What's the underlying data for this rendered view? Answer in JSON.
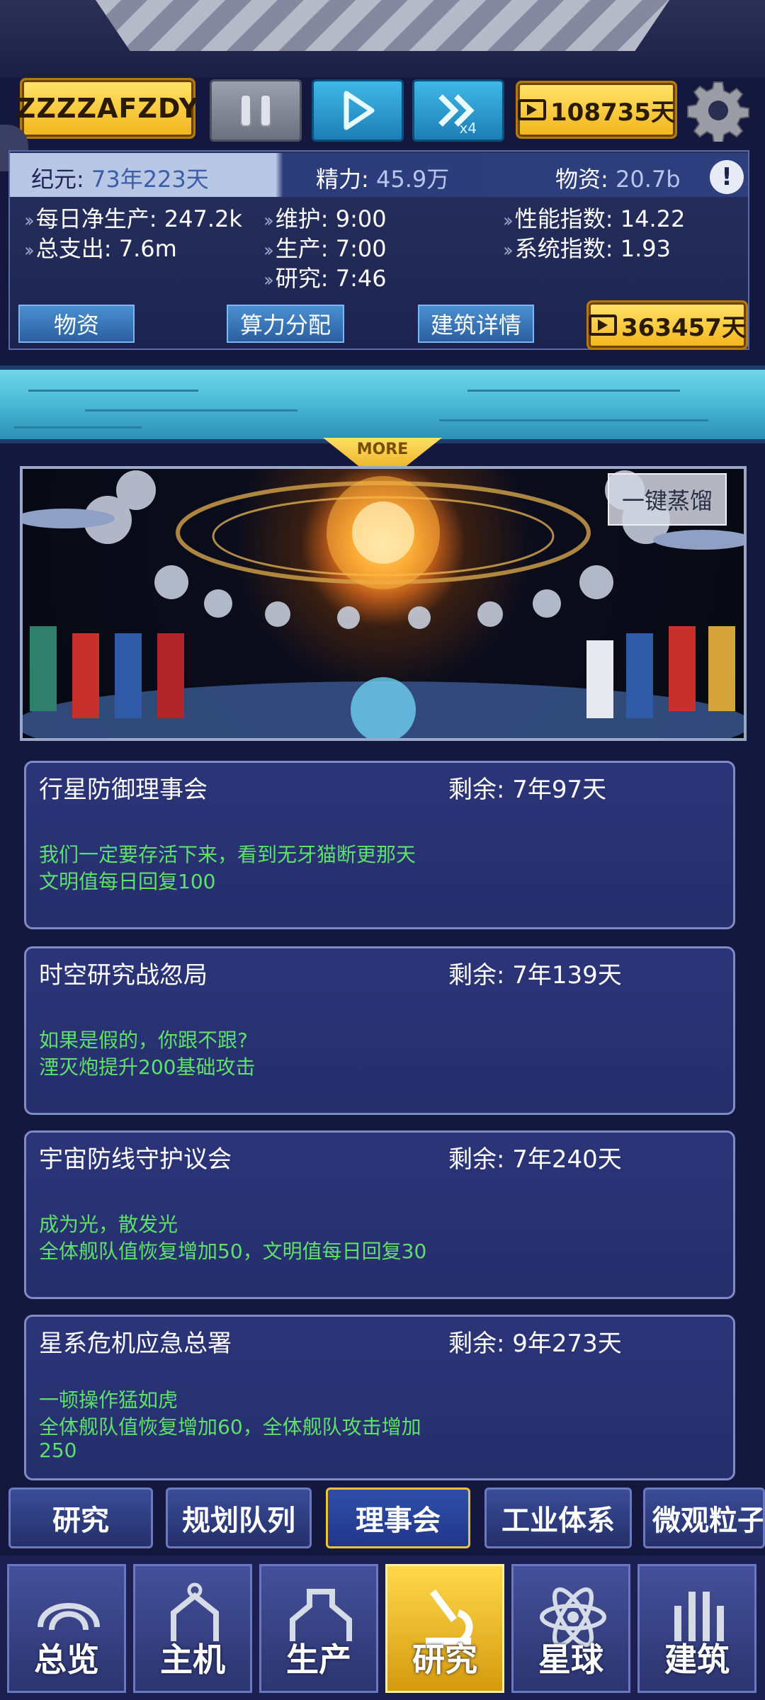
{
  "toolbar": {
    "player_name": "ZZZZAFZDY",
    "speed_multiplier": "x4",
    "time_ad_label": "108735天"
  },
  "stats": {
    "era_label": "纪元:",
    "era_value": "73年223天",
    "energy_label": "精力:",
    "energy_value": "45.9万",
    "materials_label": "物资:",
    "materials_value": "20.7b",
    "alert": "!",
    "daily_net_production": "每日净生产: 247.2k",
    "total_spending": "总支出: 7.6m",
    "maintenance": "维护: 9:00",
    "production": "生产: 7:00",
    "research": "研究: 7:46",
    "performance_index": "性能指数: 14.22",
    "system_index": "系统指数: 1.93",
    "buttons": {
      "materials": "物资",
      "compute": "算力分配",
      "building_details": "建筑详情",
      "ad_time": "363457天"
    }
  },
  "banner": {
    "more_label": "MORE",
    "distill_button": "一键蒸馏"
  },
  "council": [
    {
      "title": "行星防御理事会",
      "remaining": "剩余: 7年97天",
      "lines": [
        "我们一定要存活下来，看到无牙猫断更那天",
        "文明值每日回复100"
      ]
    },
    {
      "title": "时空研究战忽局",
      "remaining": "剩余: 7年139天",
      "lines": [
        "如果是假的，你跟不跟?",
        "湮灭炮提升200基础攻击"
      ]
    },
    {
      "title": "宇宙防线守护议会",
      "remaining": "剩余: 7年240天",
      "lines": [
        "成为光，散发光",
        "全体舰队值恢复增加50，文明值每日回复30"
      ]
    },
    {
      "title": "星系危机应急总署",
      "remaining": "剩余: 9年273天",
      "lines": [
        "一顿操作猛如虎",
        "全体舰队值恢复增加60，全体舰队攻击增加",
        "250"
      ]
    }
  ],
  "tabs": [
    "研究",
    "规划队列",
    "理事会",
    "工业体系",
    "微观粒子"
  ],
  "active_tab": "理事会",
  "nav": [
    "总览",
    "主机",
    "生产",
    "研究",
    "星球",
    "建筑"
  ],
  "active_nav": "研究",
  "colors": {
    "gold": "#f2b51c",
    "cyan": "#3fb8e6",
    "card_bg": "#2b3478",
    "effect_text": "#5ee06a",
    "panel_bg": "#26305e"
  }
}
